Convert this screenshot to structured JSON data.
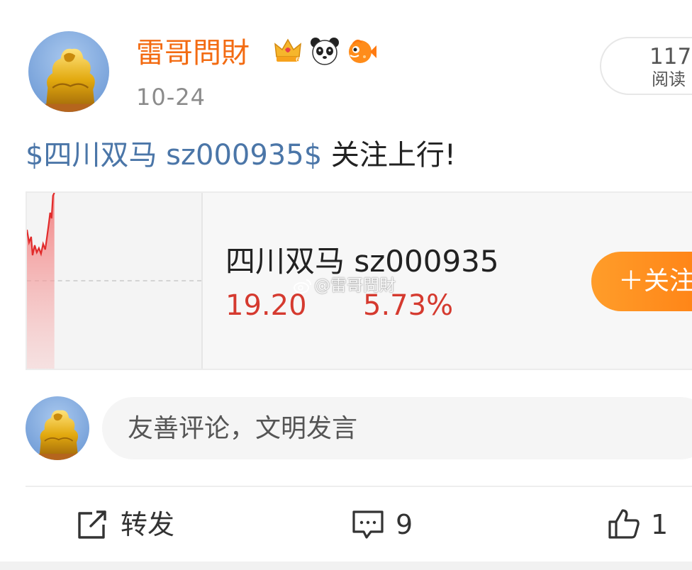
{
  "post": {
    "username": "雷哥問財",
    "time": "10-24",
    "read_count": "117",
    "read_label": "阅读",
    "text_stock_link": "$四川双马 sz000935$",
    "text_rest": " 关注上行!",
    "badges": [
      "crown-icon",
      "panda-icon",
      "fish-icon"
    ]
  },
  "stock_card": {
    "name": "四川双马 sz000935",
    "price": "19.20",
    "change": "5.73%",
    "follow_label": "＋关注",
    "watermark": "@雷哥問財",
    "colors": {
      "up": "#d53a2f",
      "button": "#ff8a1c"
    }
  },
  "comment": {
    "placeholder": "友善评论，文明发言"
  },
  "actions": {
    "share_label": "转发",
    "comment_count": "9",
    "like_count": "1"
  },
  "colors": {
    "username": "#f36b12",
    "link": "#4b76a8"
  }
}
